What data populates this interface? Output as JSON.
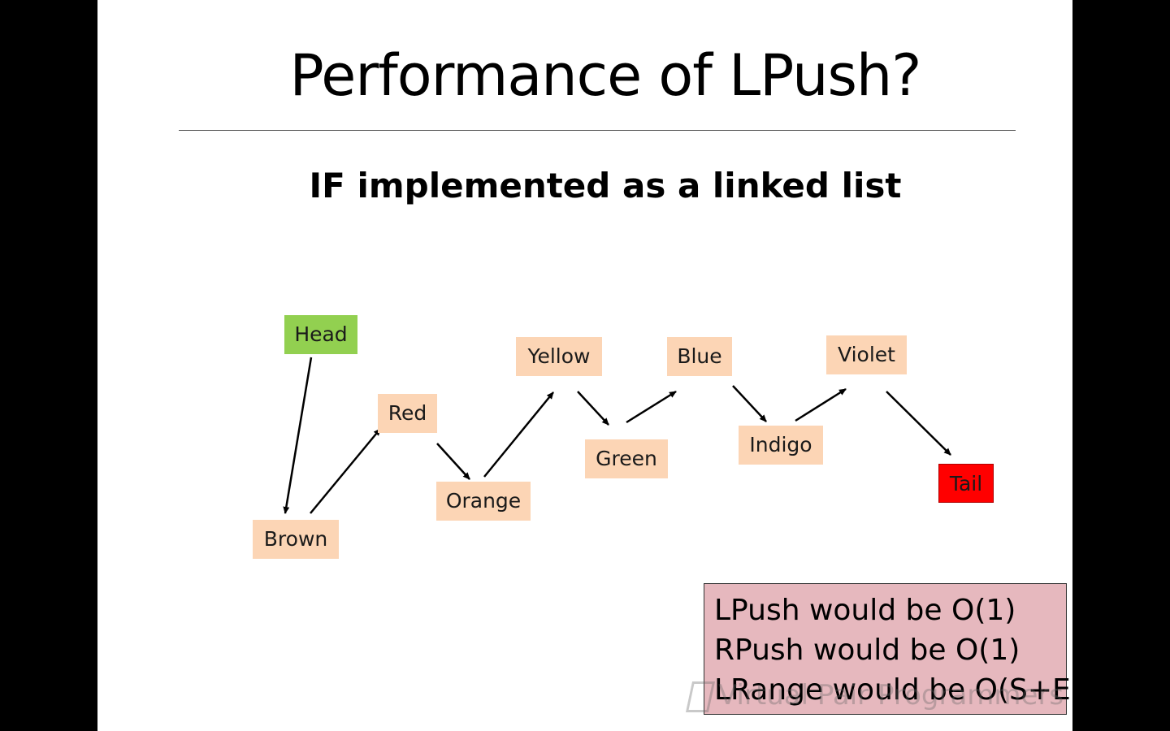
{
  "slide": {
    "title": "Performance of LPush?",
    "subtitle": "IF implemented as a linked list"
  },
  "nodes": {
    "head": "Head",
    "brown": "Brown",
    "red": "Red",
    "orange": "Orange",
    "yellow": "Yellow",
    "green": "Green",
    "blue": "Blue",
    "indigo": "Indigo",
    "violet": "Violet",
    "tail": "Tail"
  },
  "colors": {
    "head": "#92d050",
    "item": "#fcd5b5",
    "tail": "#ff0000",
    "note_bg": "#e6b8be"
  },
  "note": {
    "lines": [
      "LPush would be O(1)",
      "RPush would be O(1)",
      "LRange would be O(S+E)"
    ]
  },
  "watermark": {
    "text": "Virtual Pair Programmers"
  }
}
